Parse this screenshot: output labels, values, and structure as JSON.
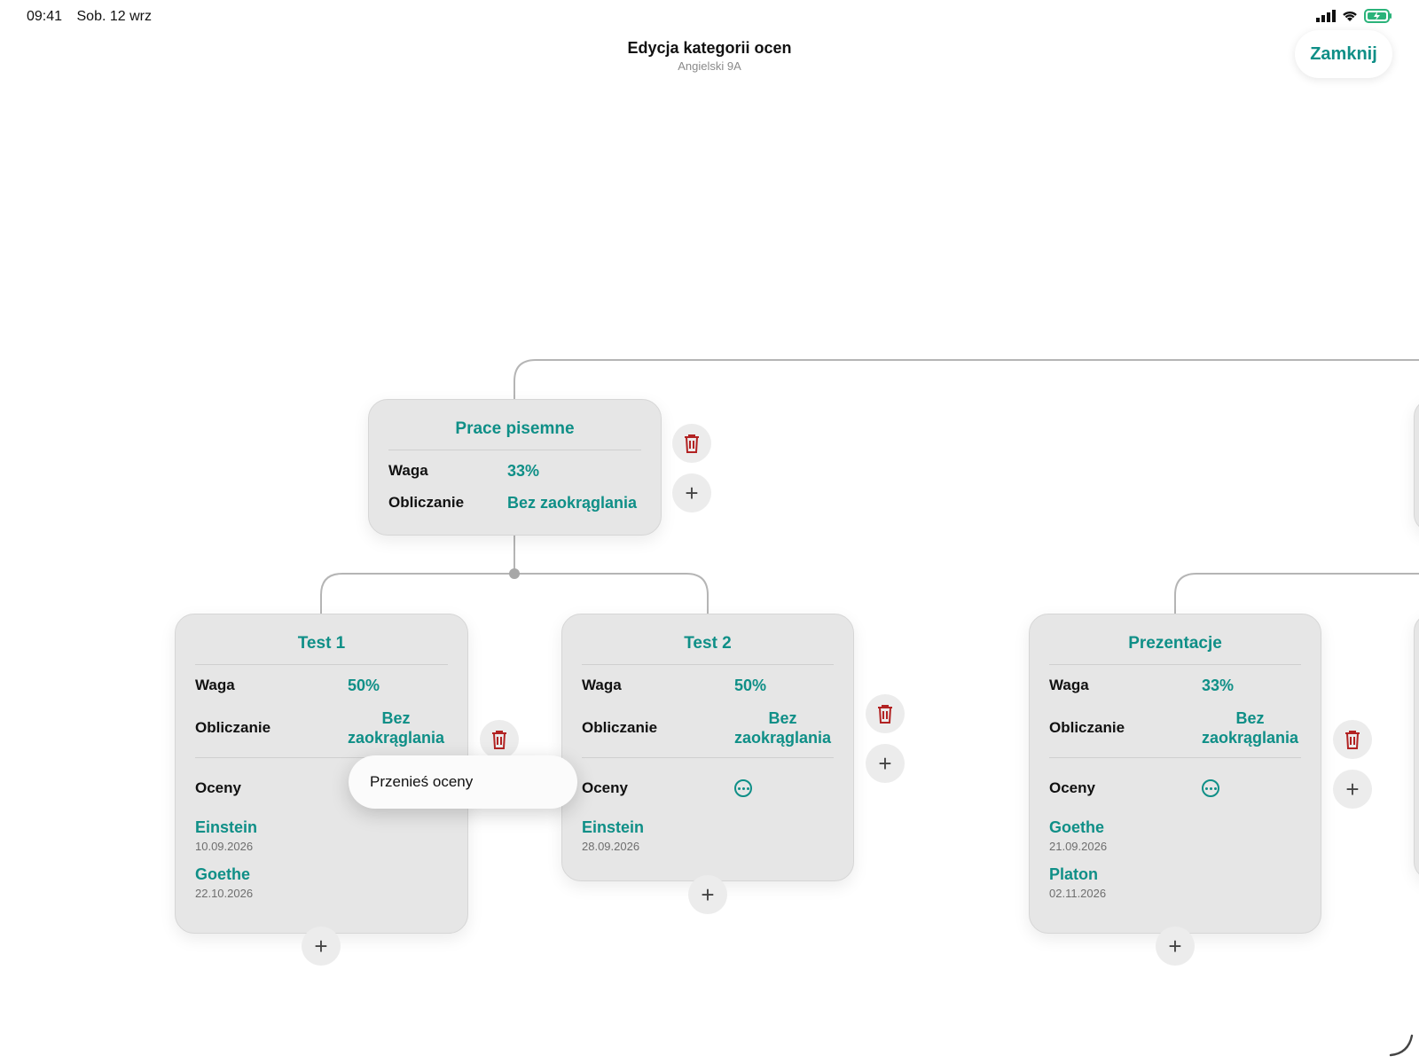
{
  "status_bar": {
    "time": "09:41",
    "date": "Sob. 12 wrz"
  },
  "header": {
    "title": "Edycja kategorii ocen",
    "subtitle": "Angielski 9A",
    "close_label": "Zamknij"
  },
  "labels": {
    "weight": "Waga",
    "calc": "Obliczanie",
    "grades": "Oceny"
  },
  "parent": {
    "title": "Prace pisemne",
    "weight": "33%",
    "calc": "Bez zaokrąglania"
  },
  "test1": {
    "title": "Test 1",
    "weight": "50%",
    "calc_line1": "Bez",
    "calc_line2": "zaokrąglania",
    "grades": [
      {
        "name": "Einstein",
        "date": "10.09.2026"
      },
      {
        "name": "Goethe",
        "date": "22.10.2026"
      }
    ]
  },
  "test2": {
    "title": "Test 2",
    "weight": "50%",
    "calc_line1": "Bez",
    "calc_line2": "zaokrąglania",
    "grades": [
      {
        "name": "Einstein",
        "date": "28.09.2026"
      }
    ]
  },
  "prez": {
    "title": "Prezentacje",
    "weight": "33%",
    "calc_line1": "Bez",
    "calc_line2": "zaokrąglania",
    "grades": [
      {
        "name": "Goethe",
        "date": "21.09.2026"
      },
      {
        "name": "Platon",
        "date": "02.11.2026"
      }
    ]
  },
  "context_menu": {
    "move_grades": "Przenieś oceny"
  },
  "colors": {
    "accent": "#0f8f87",
    "delete": "#b22222"
  }
}
